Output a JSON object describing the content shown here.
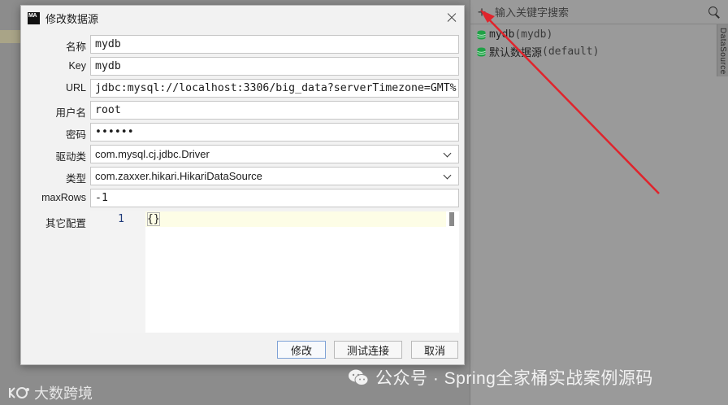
{
  "right_panel": {
    "search_placeholder": "输入关键字搜索",
    "side_tab_label": "DataSource",
    "tree": [
      {
        "name": "mydb",
        "detail": "(mydb)"
      },
      {
        "name": "默认数据源",
        "detail": "(default)"
      }
    ]
  },
  "dialog": {
    "app_icon_text": "MA",
    "title": "修改数据源",
    "fields": {
      "name": {
        "label": "名称",
        "value": "mydb"
      },
      "key": {
        "label": "Key",
        "value": "mydb"
      },
      "url": {
        "label": "URL",
        "value": "jdbc:mysql://localhost:3306/big_data?serverTimezone=GMT%"
      },
      "username": {
        "label": "用户名",
        "value": "root"
      },
      "password": {
        "label": "密码",
        "value": "••••••"
      },
      "driver": {
        "label": "驱动类",
        "value": "com.mysql.cj.jdbc.Driver"
      },
      "type": {
        "label": "类型",
        "value": "com.zaxxer.hikari.HikariDataSource"
      },
      "max_rows": {
        "label": "maxRows",
        "value": "-1"
      },
      "other_config": {
        "label": "其它配置",
        "line_number": "1",
        "code": "{}"
      }
    },
    "buttons": {
      "modify": "修改",
      "test": "测试连接",
      "cancel": "取消"
    }
  },
  "watermarks": {
    "left": "大数跨境",
    "right": "公众号 · Spring全家桶实战案例源码"
  },
  "colors": {
    "arrow": "#e0242c",
    "db_icon": "#1fa146"
  }
}
